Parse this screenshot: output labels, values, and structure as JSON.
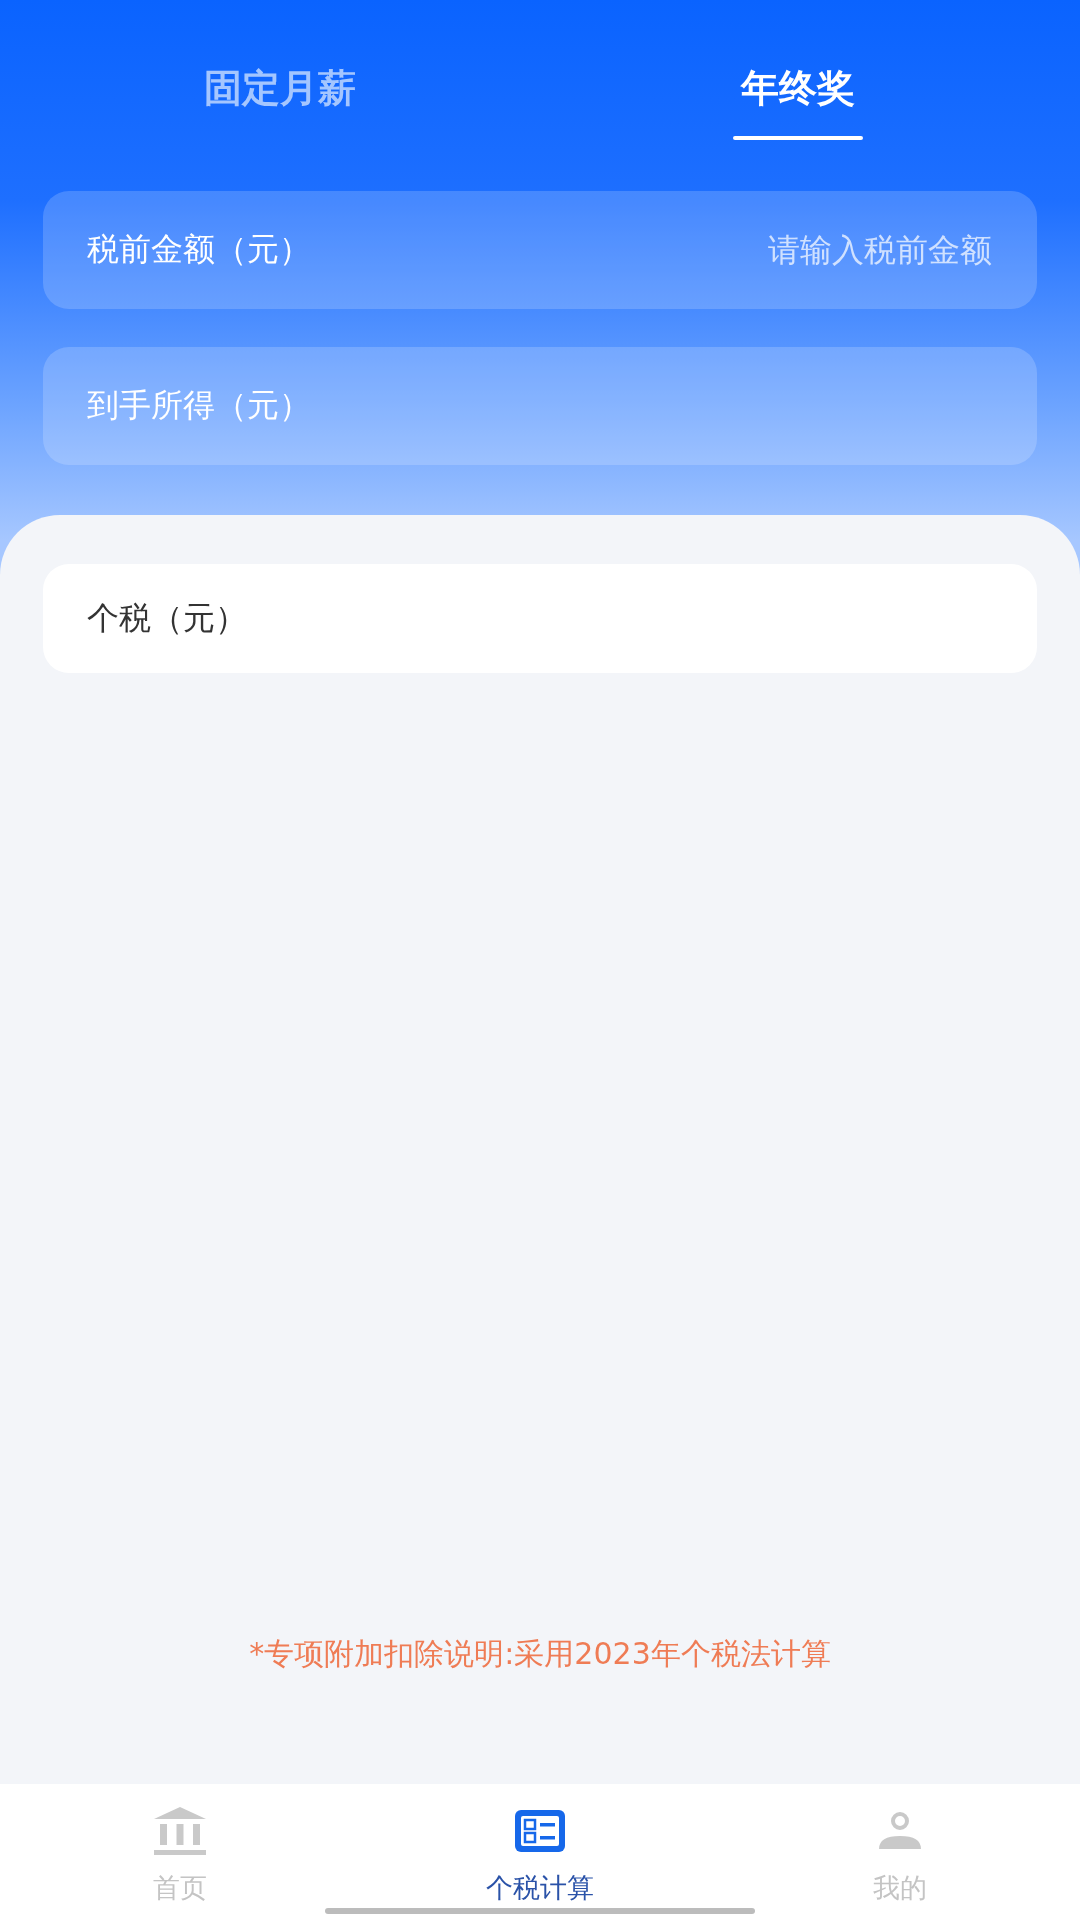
{
  "tabs": [
    {
      "label": "固定月薪",
      "selected": false
    },
    {
      "label": "年终奖",
      "selected": true
    }
  ],
  "form": {
    "fields": [
      {
        "label": "税前金额（元）",
        "placeholder": "请输入税前金额"
      },
      {
        "label": "到手所得（元）"
      }
    ]
  },
  "result": {
    "label": "个税（元）"
  },
  "note": "*专项附加扣除说明:采用2023年个税法计算",
  "bottom_nav": [
    {
      "label": "首页",
      "selected": false
    },
    {
      "label": "个税计算",
      "selected": true
    },
    {
      "label": "我的",
      "selected": false
    }
  ]
}
